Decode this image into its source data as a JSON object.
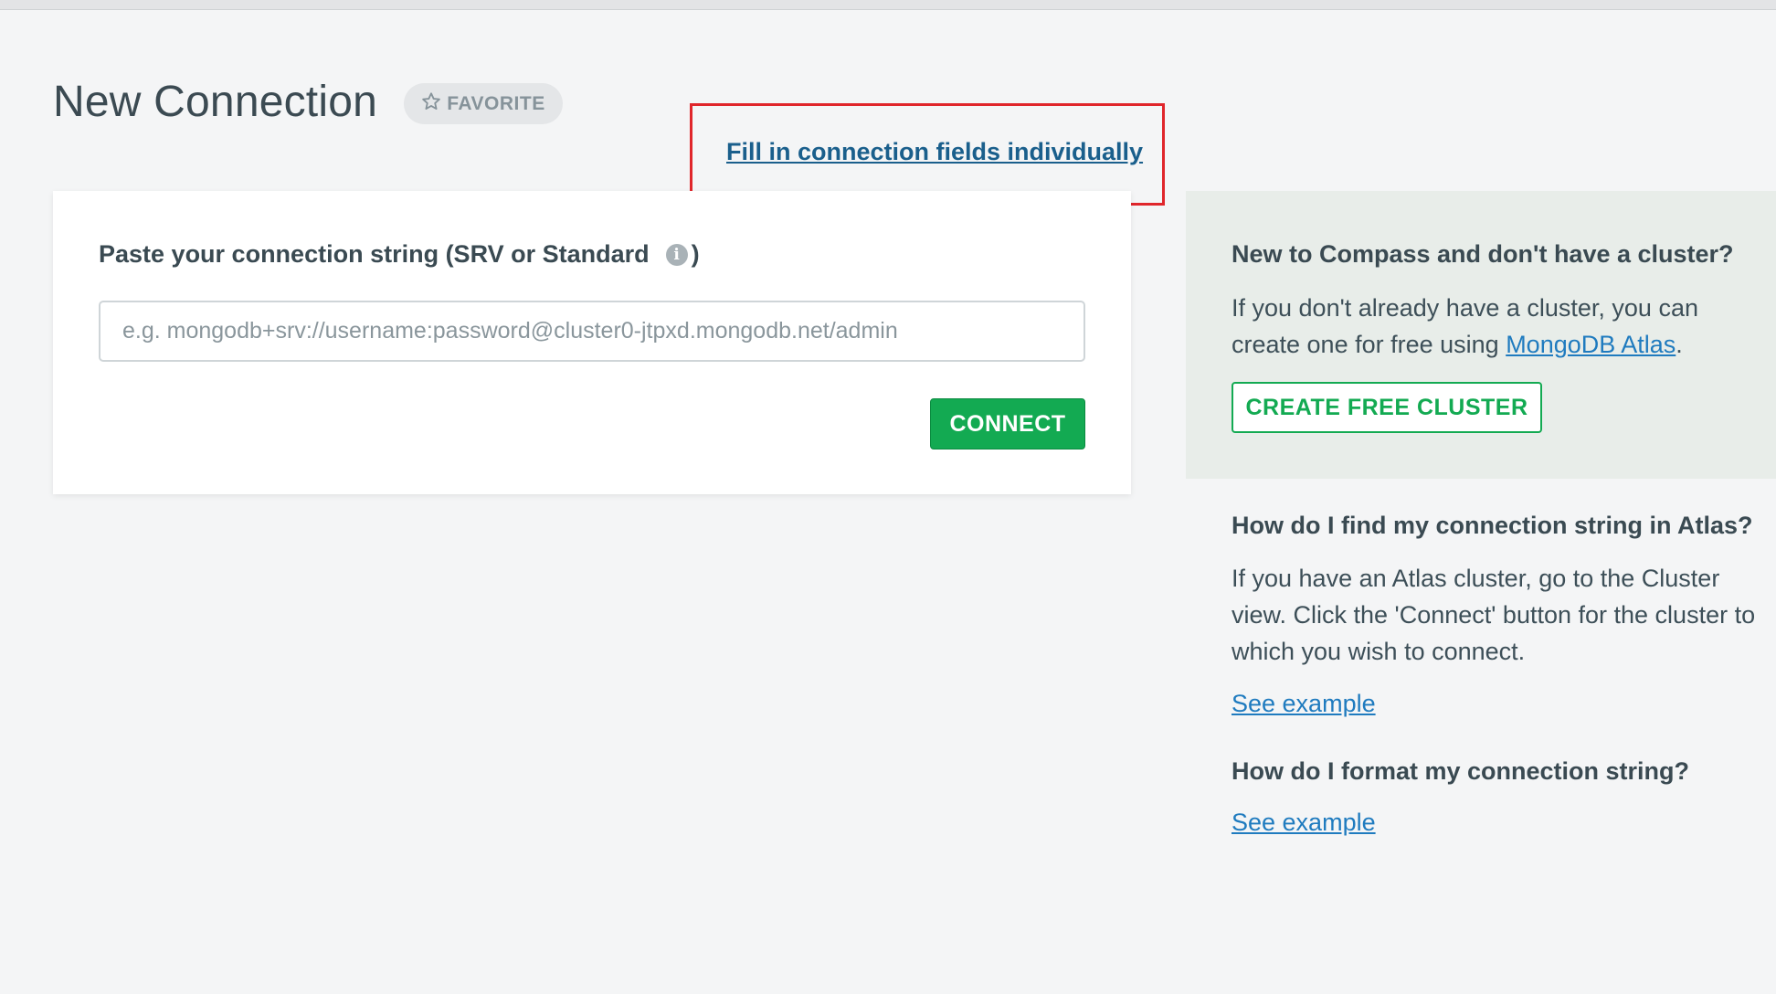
{
  "header": {
    "title": "New Connection",
    "favorite_label": "FAVORITE"
  },
  "fill_link": "Fill in connection fields individually",
  "connect_card": {
    "label": "Paste your connection string (SRV or Standard",
    "label_close": ")",
    "input_placeholder": "e.g. mongodb+srv://username:password@cluster0-jtpxd.mongodb.net/admin",
    "input_value": "",
    "connect_button": "CONNECT"
  },
  "help": {
    "new_heading": "New to Compass and don't have a cluster?",
    "new_text_before": "If you don't already have a cluster, you can create one for free using ",
    "atlas_link": "MongoDB Atlas",
    "new_text_after": ".",
    "create_button": "CREATE FREE CLUSTER",
    "find_heading": "How do I find my connection string in Atlas?",
    "find_text": "If you have an Atlas cluster, go to the Cluster view. Click the 'Connect' button for the cluster to which you wish to connect.",
    "see_example_1": "See example",
    "format_heading": "How do I format my connection string?",
    "see_example_2": "See example"
  },
  "colors": {
    "accent_green": "#13aa52",
    "link_blue": "#1f7bbf",
    "highlight_red": "#e0262b"
  }
}
